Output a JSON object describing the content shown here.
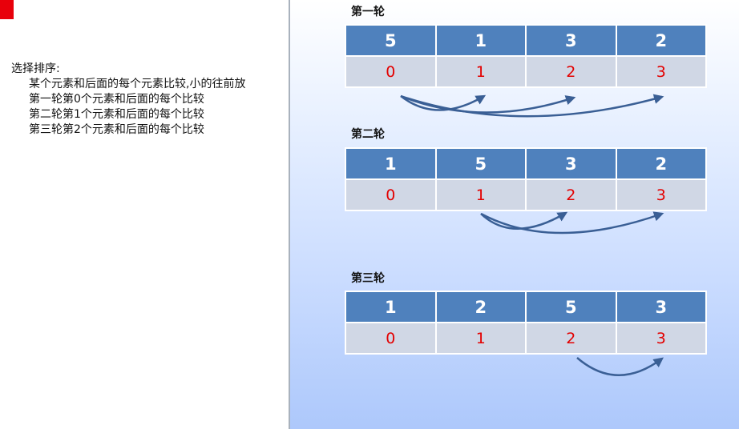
{
  "notes": {
    "heading": "选择排序:",
    "lines": [
      "某个元素和后面的每个元素比较,小的往前放",
      "第一轮第0个元素和后面的每个比较",
      "第二轮第1个元素和后面的每个比较",
      "第三轮第2个元素和后面的每个比较"
    ]
  },
  "rounds": [
    {
      "title": "第一轮",
      "values": [
        "5",
        "1",
        "3",
        "2"
      ],
      "indices": [
        "0",
        "1",
        "2",
        "3"
      ]
    },
    {
      "title": "第二轮",
      "values": [
        "1",
        "5",
        "3",
        "2"
      ],
      "indices": [
        "0",
        "1",
        "2",
        "3"
      ]
    },
    {
      "title": "第三轮",
      "values": [
        "1",
        "2",
        "5",
        "3"
      ],
      "indices": [
        "0",
        "1",
        "2",
        "3"
      ]
    }
  ],
  "colors": {
    "cell_value_bg": "#4f81bd",
    "cell_index_bg": "#d0d7e5",
    "index_text": "#e30000",
    "arrow": "#3a5f95",
    "accent_red": "#e8000b"
  }
}
